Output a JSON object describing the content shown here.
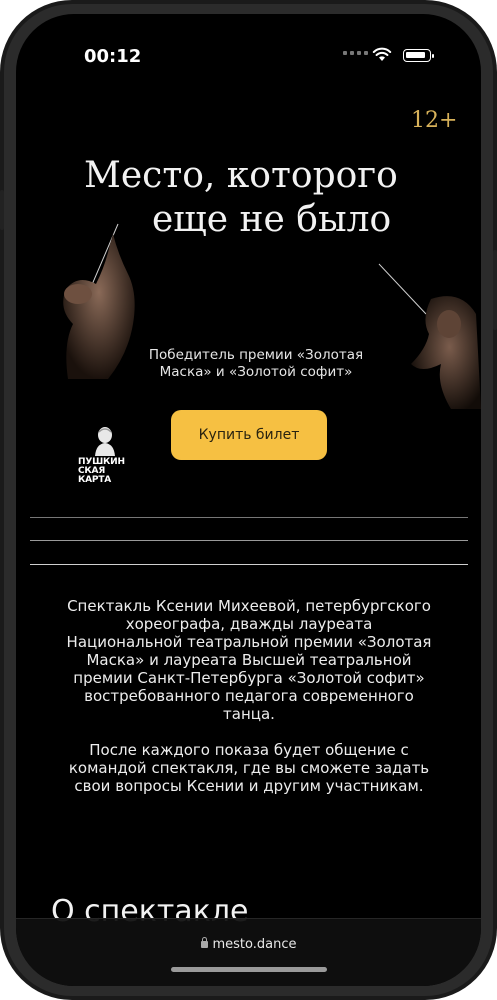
{
  "status_bar": {
    "time": "00:12"
  },
  "hero": {
    "age_rating": "12+",
    "title_line1": "Место, которого",
    "title_line2": "еще не было",
    "award": "Победитель премии «Золотая Маска» и «Золотой софит»",
    "buy_button": "Купить билет",
    "pushkin_card": "ПУШКИН\nСКАЯ\nКАРТА"
  },
  "description": {
    "paragraph1": "Спектакль Ксении Михеевой, петербургского хореографа, дважды лауреата Национальной театральной премии «Золотая Маска» и лауреата Высшей театральной премии Санкт-Петербурга «Золотой софит» востребованного педагога современного танца.",
    "paragraph2": "После каждого показа будет общение с командой спектакля, где вы сможете задать свои вопросы Ксении и другим участникам."
  },
  "section": {
    "title": "О спектакле"
  },
  "browser": {
    "url": "mesto.dance"
  },
  "colors": {
    "accent": "#f6c042",
    "age_gold": "#d8b25a",
    "background": "#000000"
  },
  "icons": [
    "signal-icon",
    "wifi-icon",
    "battery-icon",
    "lock-icon",
    "pushkin-card-logo"
  ]
}
